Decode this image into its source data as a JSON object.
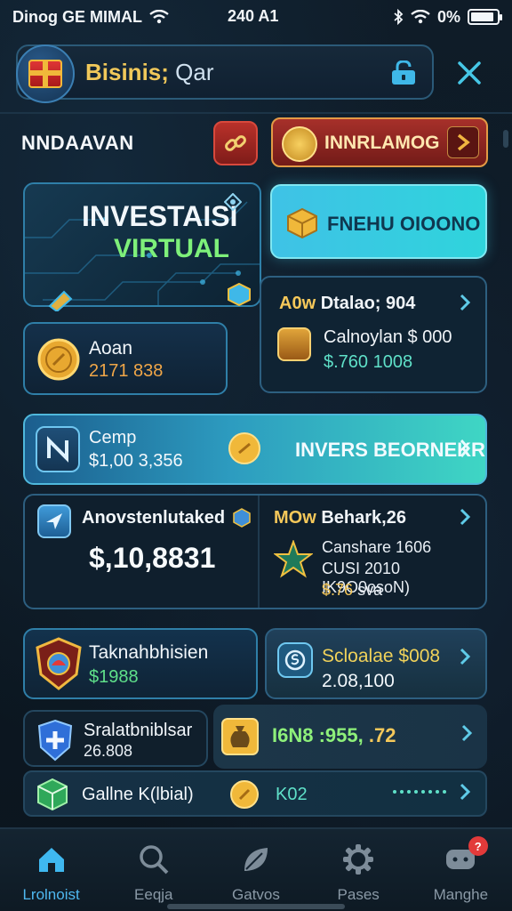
{
  "status_bar": {
    "carrier": "Dinog GE MIMAL",
    "time": "240 A1",
    "battery": "0%",
    "battery_level": 0.9
  },
  "header": {
    "title": "Bisinis;",
    "subtitle": "Qar",
    "logo_icon": "gift-box-icon",
    "lock_icon": "lock-icon",
    "close_icon": "close-icon"
  },
  "section": {
    "label": "NNDAAVAN",
    "link_icon": "link-icon",
    "rank_button": "INNRLAMOG"
  },
  "virtual_panel": {
    "title_line1": "INVESTAISI",
    "title_line2": "VIRTUAL"
  },
  "cyan_button": {
    "label": "FNEHU OIOONO"
  },
  "coin_panel": {
    "label": "Aoan",
    "value": "2171 838"
  },
  "stats_panel": {
    "row1_highlight": "A0w",
    "row1_text": "Dtalao; 904",
    "row2": "Calnoylan $ 000",
    "row3": "$.760 1008"
  },
  "banner": {
    "line1": "Cemp",
    "line2": "$1,00 3,356",
    "cta": "INVERS BEORNEKR"
  },
  "invest_card": {
    "label": "Anovstenlutaked",
    "amount": "$,10,8831",
    "r1_highlight": "MOw",
    "r1_text": "Behark,26",
    "r2": "Canshare 1606",
    "r3": "CUSI 2010 IK9O0osoN)",
    "r4_value": "$.76",
    "r4_text": "sva"
  },
  "tile_left1": {
    "label": "Taknahbhisien",
    "value": "$1988"
  },
  "tile_right1": {
    "label": "Scloalae $008",
    "value": "2.08,100"
  },
  "tile_left2": {
    "label": "Sralatbniblsar",
    "value": "26.808"
  },
  "tile_right2": {
    "value_green": "I6N8 :955,",
    "value_yellow": ".72"
  },
  "tile_bottom": {
    "label": "Gallne K(lbial)",
    "value": "K02"
  },
  "tabbar": {
    "tabs": [
      {
        "label": "Lrolnoist",
        "icon": "home-icon",
        "active": true
      },
      {
        "label": "Eeqja",
        "icon": "search-icon",
        "active": false
      },
      {
        "label": "Gatvos",
        "icon": "leaf-icon",
        "active": false
      },
      {
        "label": "Pases",
        "icon": "gear-icon",
        "active": false
      },
      {
        "label": "Manghe",
        "icon": "chat-icon",
        "active": false,
        "badge": "?"
      }
    ]
  },
  "colors": {
    "accent_cyan": "#3fc2e6",
    "accent_gold": "#f5c85a",
    "accent_green": "#7ef07a",
    "accent_red": "#a7302a"
  }
}
